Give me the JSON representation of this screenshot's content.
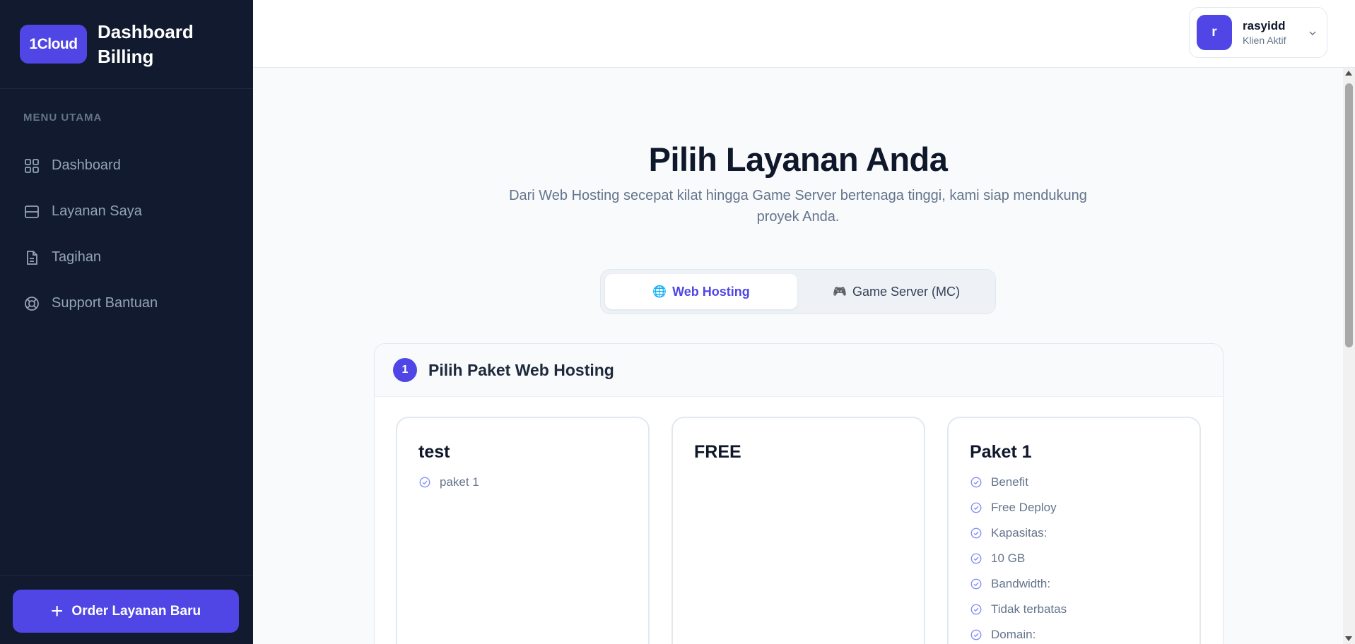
{
  "brand": {
    "logo_text": "1Cloud",
    "title_line1": "Dashboard",
    "title_line2": "Billing"
  },
  "sidebar": {
    "menu_heading": "MENU UTAMA",
    "items": [
      {
        "label": "Dashboard",
        "icon": "grid-icon"
      },
      {
        "label": "Layanan Saya",
        "icon": "server-icon"
      },
      {
        "label": "Tagihan",
        "icon": "document-icon"
      },
      {
        "label": "Support Bantuan",
        "icon": "lifebuoy-icon"
      }
    ],
    "order_button": "Order Layanan Baru"
  },
  "user": {
    "initial": "r",
    "name": "rasyidd",
    "role": "Klien Aktif"
  },
  "hero": {
    "title": "Pilih Layanan Anda",
    "subtitle": "Dari Web Hosting secepat kilat hingga Game Server bertenaga tinggi, kami siap mendukung proyek Anda."
  },
  "tabs": {
    "web": {
      "icon": "🌐",
      "label": "Web Hosting"
    },
    "game": {
      "icon": "🎮",
      "label": "Game Server (MC)"
    }
  },
  "step": {
    "number": "1",
    "title": "Pilih Paket Web Hosting"
  },
  "packages": [
    {
      "name": "test",
      "features": [
        "paket 1"
      ]
    },
    {
      "name": "FREE",
      "features": []
    },
    {
      "name": "Paket 1",
      "features": [
        "Benefit",
        "Free Deploy",
        "Kapasitas:",
        "10 GB",
        "Bandwidth:",
        "Tidak terbatas",
        "Domain:"
      ]
    }
  ],
  "colors": {
    "accent": "#4f46e5",
    "sidebar_bg": "#111a2e"
  }
}
